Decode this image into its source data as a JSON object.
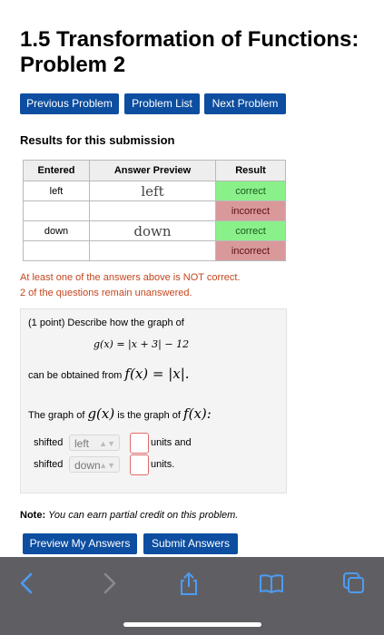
{
  "page": {
    "title_line1": "1.5 Transformation of Functions:",
    "title_line2": "Problem 2"
  },
  "nav": {
    "previous": "Previous Problem",
    "list": "Problem List",
    "next": "Next Problem"
  },
  "results": {
    "heading": "Results for this submission",
    "columns": [
      "Entered",
      "Answer Preview",
      "Result"
    ],
    "rows": [
      {
        "entered": "left",
        "preview": "left",
        "result": "correct"
      },
      {
        "entered": "",
        "preview": "",
        "result": "incorrect"
      },
      {
        "entered": "down",
        "preview": "down",
        "result": "correct"
      },
      {
        "entered": "",
        "preview": "",
        "result": "incorrect"
      }
    ],
    "message_1": "At least one of the answers above is NOT correct.",
    "message_2": "2 of the questions remain unanswered."
  },
  "problem": {
    "intro": "(1 point) Describe how the graph of",
    "equation": "g(x) = |x + 3| − 12",
    "obtained_text": "can be obtained from",
    "obtained_math": "f(x) = |x|.",
    "graph_text_a": "The graph of",
    "graph_math_g": "g(x)",
    "graph_text_b": "is the graph of",
    "graph_math_f": "f(x):",
    "line1_label": "shifted",
    "line1_select": "left",
    "line1_suffix": "units and",
    "line2_label": "shifted",
    "line2_select": "down",
    "line2_suffix": "units."
  },
  "note": {
    "label": "Note:",
    "text": "You can earn partial credit on this problem."
  },
  "actions": {
    "preview": "Preview My Answers",
    "submit": "Submit Answers"
  },
  "toolbar": {
    "icons": [
      "back-icon",
      "forward-icon",
      "share-icon",
      "bookmarks-icon",
      "tabs-icon"
    ]
  },
  "colors": {
    "button_blue": "#0d4ea0",
    "correct_green": "#8af08a",
    "incorrect_red": "#d9989a",
    "warning_text": "#c3461f",
    "toolbar_gray": "#5f5f63",
    "ios_blue": "#4c9cf5"
  }
}
